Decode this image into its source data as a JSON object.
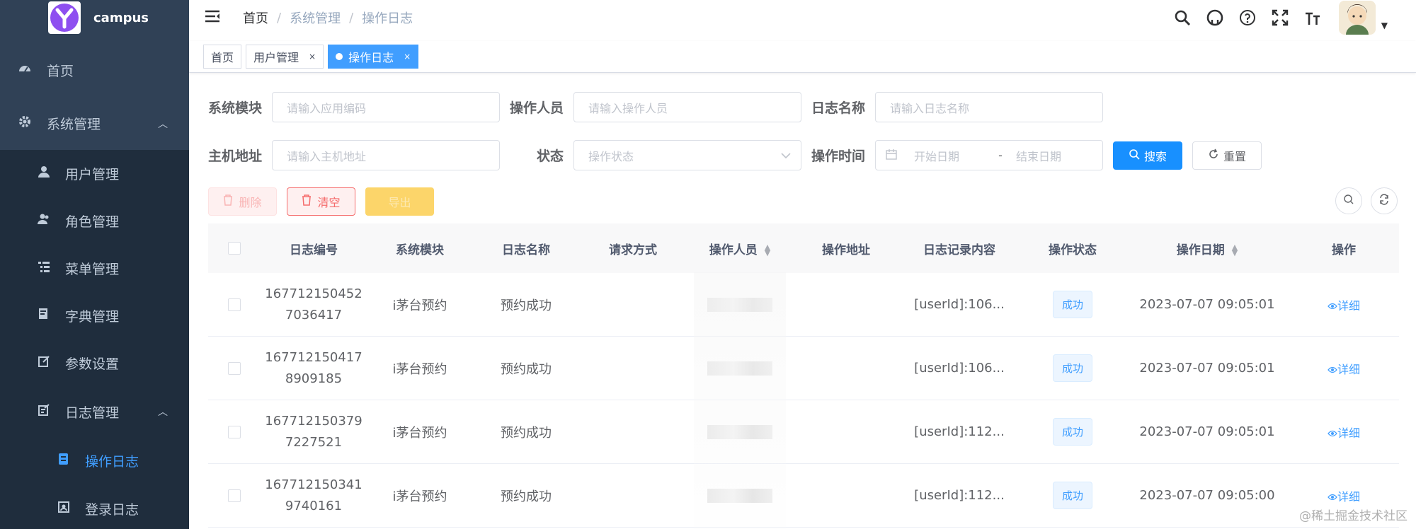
{
  "app": {
    "logo_text": "campus"
  },
  "sidebar": {
    "items": [
      {
        "label": "首页",
        "icon": "dashboard-icon"
      },
      {
        "label": "系统管理",
        "icon": "gear-icon"
      },
      {
        "label": "用户管理",
        "icon": "user-icon"
      },
      {
        "label": "角色管理",
        "icon": "peoples-icon"
      },
      {
        "label": "菜单管理",
        "icon": "tree-table-icon"
      },
      {
        "label": "字典管理",
        "icon": "dict-icon"
      },
      {
        "label": "参数设置",
        "icon": "edit-icon"
      },
      {
        "label": "日志管理",
        "icon": "log-icon"
      },
      {
        "label": "操作日志",
        "icon": "form-icon"
      },
      {
        "label": "登录日志",
        "icon": "logininfor-icon"
      }
    ]
  },
  "navbar": {
    "breadcrumb": [
      "首页",
      "系统管理",
      "操作日志"
    ],
    "separator": "/"
  },
  "tags": {
    "items": [
      {
        "label": "首页"
      },
      {
        "label": "用户管理",
        "close": "×"
      },
      {
        "label": "操作日志",
        "close": "×"
      }
    ]
  },
  "search": {
    "module_label": "系统模块",
    "module_placeholder": "请输入应用编码",
    "operator_label": "操作人员",
    "operator_placeholder": "请输入操作人员",
    "logname_label": "日志名称",
    "logname_placeholder": "请输入日志名称",
    "host_label": "主机地址",
    "host_placeholder": "请输入主机地址",
    "status_label": "状态",
    "status_placeholder": "操作状态",
    "time_label": "操作时间",
    "start_placeholder": "开始日期",
    "range_sep": "-",
    "end_placeholder": "结束日期",
    "search_button": "搜索",
    "reset_button": "重置"
  },
  "toolbar": {
    "delete_label": "删除",
    "clear_label": "清空",
    "export_label": "导出"
  },
  "table": {
    "columns": [
      "日志编号",
      "系统模块",
      "日志名称",
      "请求方式",
      "操作人员",
      "操作地址",
      "日志记录内容",
      "操作状态",
      "操作日期",
      "操作"
    ],
    "rows": [
      {
        "id_line1": "167712150452",
        "id_line2": "7036417",
        "module": "i茅台预约",
        "name": "预约成功",
        "method": "",
        "address": "",
        "content": "[userId]:106...",
        "status": "成功",
        "date": "2023-07-07 09:05:01",
        "action": "详细"
      },
      {
        "id_line1": "167712150417",
        "id_line2": "8909185",
        "module": "i茅台预约",
        "name": "预约成功",
        "method": "",
        "address": "",
        "content": "[userId]:106...",
        "status": "成功",
        "date": "2023-07-07 09:05:01",
        "action": "详细"
      },
      {
        "id_line1": "167712150379",
        "id_line2": "7227521",
        "module": "i茅台预约",
        "name": "预约成功",
        "method": "",
        "address": "",
        "content": "[userId]:112...",
        "status": "成功",
        "date": "2023-07-07 09:05:01",
        "action": "详细"
      },
      {
        "id_line1": "167712150341",
        "id_line2": "9740161",
        "module": "i茅台预约",
        "name": "预约成功",
        "method": "",
        "address": "",
        "content": "[userId]:112...",
        "status": "成功",
        "date": "2023-07-07 09:05:00",
        "action": "详细"
      }
    ]
  },
  "watermark": "@稀土掘金技术社区",
  "colors": {
    "primary": "#409eff",
    "sidebar_bg": "#304156",
    "submenu_bg": "#1f2d3d",
    "danger_light": "#fef0f0",
    "warning": "#fcd56a"
  }
}
